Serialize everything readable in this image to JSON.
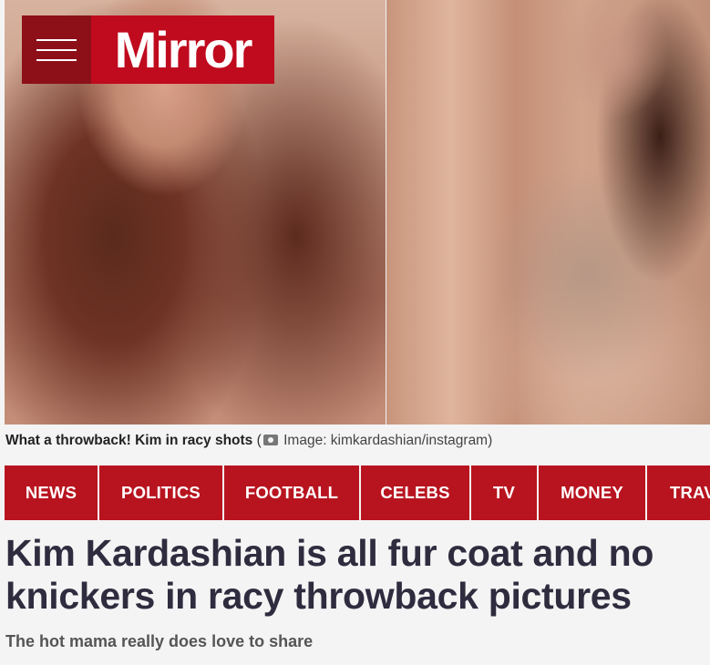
{
  "brand": {
    "logo_text": "Mirror",
    "brand_color": "#c00a1e",
    "menu_icon": "hamburger-menu-icon"
  },
  "hero": {
    "caption_main": "What a throwback! Kim in racy shots",
    "caption_open": "(",
    "camera_icon": "camera-icon",
    "caption_credit": "Image: kimkardashian/instagram)"
  },
  "nav": {
    "items": [
      {
        "label": "NEWS"
      },
      {
        "label": "POLITICS"
      },
      {
        "label": "FOOTBALL"
      },
      {
        "label": "CELEBS"
      },
      {
        "label": "TV"
      },
      {
        "label": "MONEY"
      },
      {
        "label": "TRAV"
      }
    ],
    "color": "#b8141f"
  },
  "article": {
    "headline": "Kim Kardashian is all fur coat and no knickers in racy throwback pictures",
    "standfirst": "The hot mama really does love to share"
  }
}
